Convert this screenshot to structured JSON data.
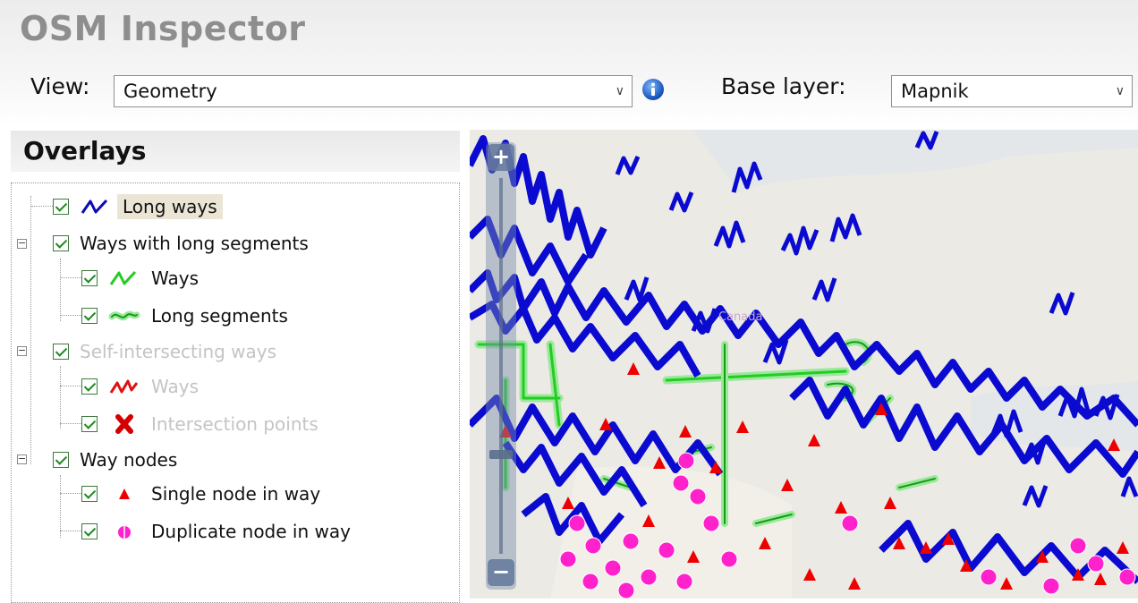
{
  "app": {
    "title": "OSM Inspector"
  },
  "toolbar": {
    "view_label": "View:",
    "view_value": "Geometry",
    "info_icon": "info-icon",
    "base_layer_label": "Base layer:",
    "base_layer_value": "Mapnik"
  },
  "overlays": {
    "title": "Overlays",
    "items": [
      {
        "label": "Long ways",
        "icon": "long-ways-icon",
        "checked": true,
        "enabled": true,
        "highlighted": true
      },
      {
        "label": "Ways with long segments",
        "checked": true,
        "enabled": true,
        "expandable": true,
        "expanded": true
      },
      {
        "label": "Ways",
        "icon": "green-ways-icon",
        "checked": true,
        "enabled": true
      },
      {
        "label": "Long segments",
        "icon": "green-segment-icon",
        "checked": true,
        "enabled": true
      },
      {
        "label": "Self-intersecting ways",
        "checked": true,
        "enabled": false,
        "expandable": true,
        "expanded": true
      },
      {
        "label": "Ways",
        "icon": "red-ways-icon",
        "checked": true,
        "enabled": false
      },
      {
        "label": "Intersection points",
        "icon": "red-x-icon",
        "checked": true,
        "enabled": false
      },
      {
        "label": "Way nodes",
        "checked": true,
        "enabled": true,
        "expandable": true,
        "expanded": true
      },
      {
        "label": "Single node in way",
        "icon": "red-triangle-icon",
        "checked": true,
        "enabled": true
      },
      {
        "label": "Duplicate node in way",
        "icon": "magenta-dot-icon",
        "checked": true,
        "enabled": true
      }
    ]
  },
  "map": {
    "place_label": "Canada",
    "zoom_in": "+",
    "zoom_out": "−",
    "colors": {
      "long_ways": "#0000cc",
      "long_segments": "#22cc22",
      "single_node": "#ee0000",
      "duplicate_node": "#ff33cc"
    }
  }
}
